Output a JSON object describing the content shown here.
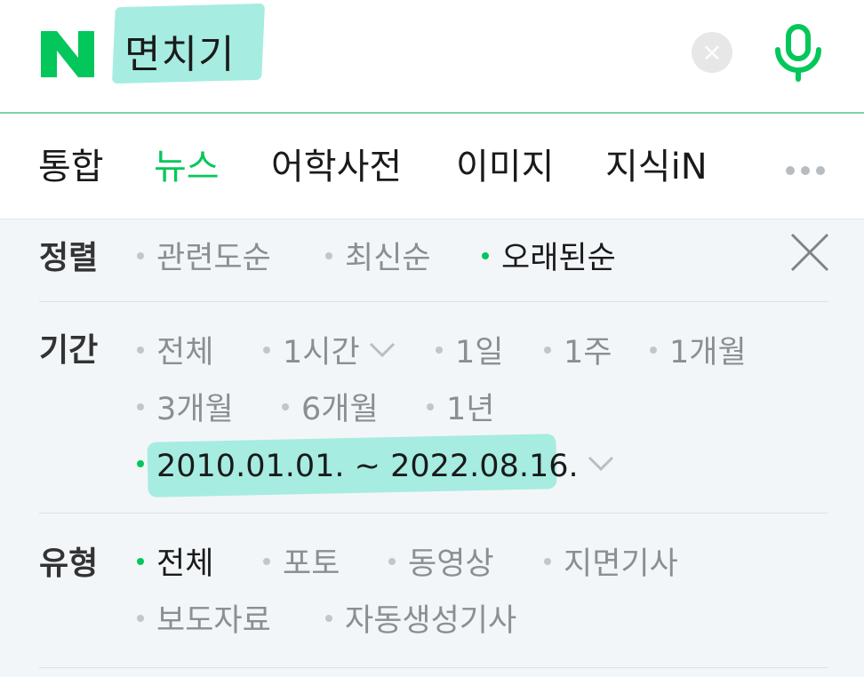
{
  "search": {
    "query": "면치기",
    "clear_icon": "close-icon",
    "voice_icon": "microphone-icon"
  },
  "brand": {
    "logo_letter": "N",
    "accent": "#03c75a"
  },
  "tabs": [
    {
      "label": "통합",
      "active": false
    },
    {
      "label": "뉴스",
      "active": true
    },
    {
      "label": "어학사전",
      "active": false
    },
    {
      "label": "이미지",
      "active": false
    },
    {
      "label": "지식iN",
      "active": false
    }
  ],
  "filters": {
    "sort": {
      "label": "정렬",
      "options": [
        "관련도순",
        "최신순",
        "오래된순"
      ],
      "selected": "오래된순"
    },
    "period": {
      "label": "기간",
      "options": [
        "전체",
        "1시간",
        "1일",
        "1주",
        "1개월",
        "3개월",
        "6개월",
        "1년"
      ],
      "custom_range": "2010.01.01. ~ 2022.08.16.",
      "selected": "custom_range"
    },
    "type": {
      "label": "유형",
      "options": [
        "전체",
        "포토",
        "동영상",
        "지면기사",
        "보도자료",
        "자동생성기사"
      ],
      "selected": "전체"
    }
  }
}
